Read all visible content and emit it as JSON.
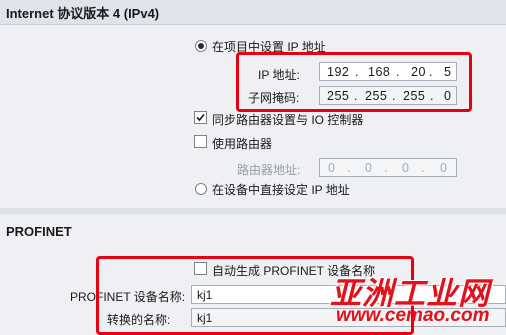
{
  "ipv4": {
    "title": "Internet 协议版本 4 (IPv4)",
    "radio_project_label": "在项目中设置 IP 地址",
    "ip_label": "IP 地址:",
    "ip_octets": [
      "192",
      "168",
      "20",
      "5"
    ],
    "subnet_label": "子网掩码:",
    "subnet_octets": [
      "255",
      "255",
      "255",
      "0"
    ],
    "sync_router_label": "同步路由器设置与 IO 控制器",
    "use_router_label": "使用路由器",
    "router_addr_label": "路由器地址:",
    "router_octets": [
      "0",
      "0",
      "0",
      "0"
    ],
    "radio_device_label": "在设备中直接设定 IP 地址"
  },
  "profinet": {
    "title": "PROFINET",
    "auto_name_label": "自动生成 PROFINET 设备名称",
    "device_name_label": "PROFINET 设备名称:",
    "device_name_value": "kj1",
    "converted_name_label": "转换的名称:",
    "converted_name_value": "kj1"
  },
  "watermark": {
    "brand": "亚洲工业网",
    "url": "www.cemao.com"
  },
  "colors": {
    "highlight": "#e60012",
    "background": "#eef0f3"
  }
}
